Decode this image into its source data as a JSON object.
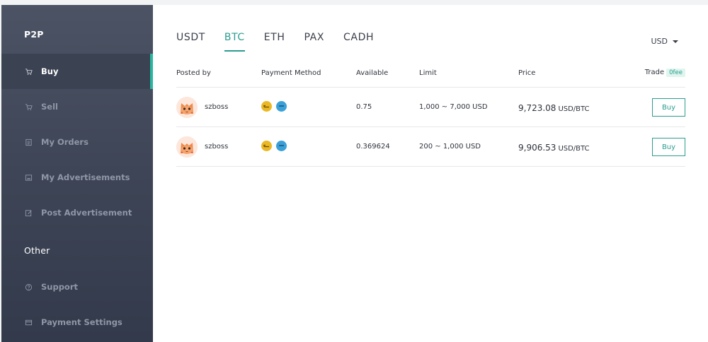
{
  "sidebar": {
    "sections": [
      {
        "title": "P2P"
      },
      {
        "title": "Other"
      }
    ],
    "items": [
      {
        "label": "Buy",
        "icon": "cart-icon",
        "active": true
      },
      {
        "label": "Sell",
        "icon": "cart-icon",
        "active": false
      },
      {
        "label": "My Orders",
        "icon": "document-icon",
        "active": false
      },
      {
        "label": "My Advertisements",
        "icon": "image-icon",
        "active": false
      },
      {
        "label": "Post Advertisement",
        "icon": "edit-icon",
        "active": false
      },
      {
        "label": "Support",
        "icon": "help-icon",
        "active": false
      },
      {
        "label": "Payment Settings",
        "icon": "card-icon",
        "active": false
      }
    ]
  },
  "tabs": [
    {
      "label": "USDT",
      "active": false
    },
    {
      "label": "BTC",
      "active": true
    },
    {
      "label": "ETH",
      "active": false
    },
    {
      "label": "PAX",
      "active": false
    },
    {
      "label": "CADH",
      "active": false
    }
  ],
  "currency": {
    "selected": "USD"
  },
  "table": {
    "headers": {
      "posted_by": "Posted by",
      "payment_method": "Payment Method",
      "available": "Available",
      "limit": "Limit",
      "price": "Price",
      "trade": "Trade",
      "fee_badge": "0fee"
    },
    "rows": [
      {
        "user": "szboss",
        "available": "0.75",
        "limit": "1,000 ~ 7,000 USD",
        "price": "9,723.08",
        "price_unit": "USD/BTC",
        "action": "Buy"
      },
      {
        "user": "szboss",
        "available": "0.369624",
        "limit": "200 ~ 1,000 USD",
        "price": "9,906.53",
        "price_unit": "USD/BTC",
        "action": "Buy"
      }
    ]
  },
  "colors": {
    "accent": "#2a9d8f",
    "sidebar_top": "#4c5364",
    "sidebar_bottom": "#333a4b",
    "payment_gold": "#e9b824",
    "payment_blue": "#3aa0d8"
  }
}
